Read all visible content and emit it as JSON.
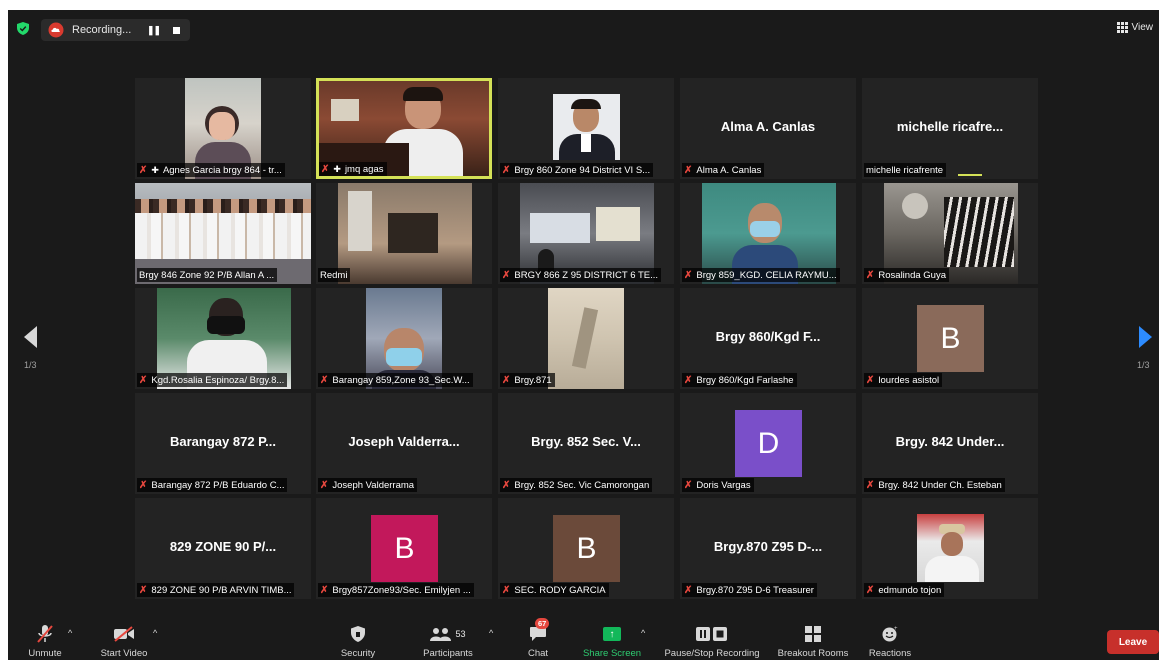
{
  "topbar": {
    "recording_label": "Recording...",
    "view_label": "View"
  },
  "nav": {
    "page_left": "1/3",
    "page_right": "1/3"
  },
  "tiles": [
    {
      "name": "Agnes Garcia brgy 864 - tr...",
      "big": "",
      "avatar": "",
      "pinned": true
    },
    {
      "name": "jmq agas",
      "big": "",
      "avatar": "",
      "pinned": true
    },
    {
      "name": "Brgy 860 Zone 94 District VI S...",
      "big": "",
      "avatar": ""
    },
    {
      "name": "Alma A. Canlas",
      "big": "Alma A. Canlas",
      "avatar": ""
    },
    {
      "name": "michelle ricafrente",
      "big": "michelle  ricafre...",
      "avatar": "",
      "muted": false
    },
    {
      "name": "Brgy 846 Zone 92 P/B Allan A ...",
      "big": "",
      "avatar": "",
      "muted": false
    },
    {
      "name": "Redmi",
      "big": "",
      "avatar": "",
      "muted": false
    },
    {
      "name": "BRGY 866 Z 95 DISTRICT 6 TE...",
      "big": "",
      "avatar": ""
    },
    {
      "name": "Brgy 859_KGD. CELIA RAYMU...",
      "big": "",
      "avatar": ""
    },
    {
      "name": "Rosalinda Guya",
      "big": "",
      "avatar": ""
    },
    {
      "name": "Kgd.Rosalia Espinoza/ Brgy.8...",
      "big": "",
      "avatar": ""
    },
    {
      "name": "Barangay 859,Zone 93_Sec.W...",
      "big": "",
      "avatar": ""
    },
    {
      "name": "Brgy.871",
      "big": "",
      "avatar": ""
    },
    {
      "name": "Brgy 860/Kgd Farlashe",
      "big": "Brgy 860/Kgd F...",
      "avatar": ""
    },
    {
      "name": "lourdes asistol",
      "big": "",
      "avatar": "B"
    },
    {
      "name": "Barangay 872 P/B Eduardo C...",
      "big": "Barangay 872 P...",
      "avatar": ""
    },
    {
      "name": "Joseph Valderrama",
      "big": "Joseph  Valderra...",
      "avatar": ""
    },
    {
      "name": "Brgy. 852 Sec. Vic Camorongan",
      "big": "Brgy. 852 Sec. V...",
      "avatar": ""
    },
    {
      "name": "Doris Vargas",
      "big": "",
      "avatar": "D"
    },
    {
      "name": "Brgy. 842 Under Ch. Esteban",
      "big": "Brgy. 842 Under...",
      "avatar": ""
    },
    {
      "name": "829 ZONE 90 P/B ARVIN TIMB...",
      "big": "829 ZONE 90 P/...",
      "avatar": ""
    },
    {
      "name": "Brgy857Zone93/Sec. Emilyjen ...",
      "big": "",
      "avatar": "B"
    },
    {
      "name": "SEC. RODY GARCIA",
      "big": "",
      "avatar": "B"
    },
    {
      "name": "Brgy.870 Z95 D-6 Treasurer",
      "big": "Brgy.870 Z95 D-...",
      "avatar": ""
    },
    {
      "name": "edmundo tojon",
      "big": "",
      "avatar": ""
    }
  ],
  "toolbar": {
    "unmute": "Unmute",
    "start_video": "Start Video",
    "security": "Security",
    "participants": "Participants",
    "participants_count": "53",
    "chat": "Chat",
    "chat_badge": "67",
    "share_screen": "Share Screen",
    "pause_recording": "Pause/Stop Recording",
    "breakout_rooms": "Breakout Rooms",
    "reactions": "Reactions",
    "leave": "Leave"
  },
  "colors": {
    "speaking_border": "#d4e157",
    "mute_red": "#e5473e",
    "share_green": "#12b85a",
    "leave_red": "#c7302b",
    "avatar_lourdes": "#8a6a5a",
    "avatar_doris": "#7a4fc9",
    "avatar_emilyjen": "#c2185b",
    "avatar_rody": "#6b4a3a"
  }
}
